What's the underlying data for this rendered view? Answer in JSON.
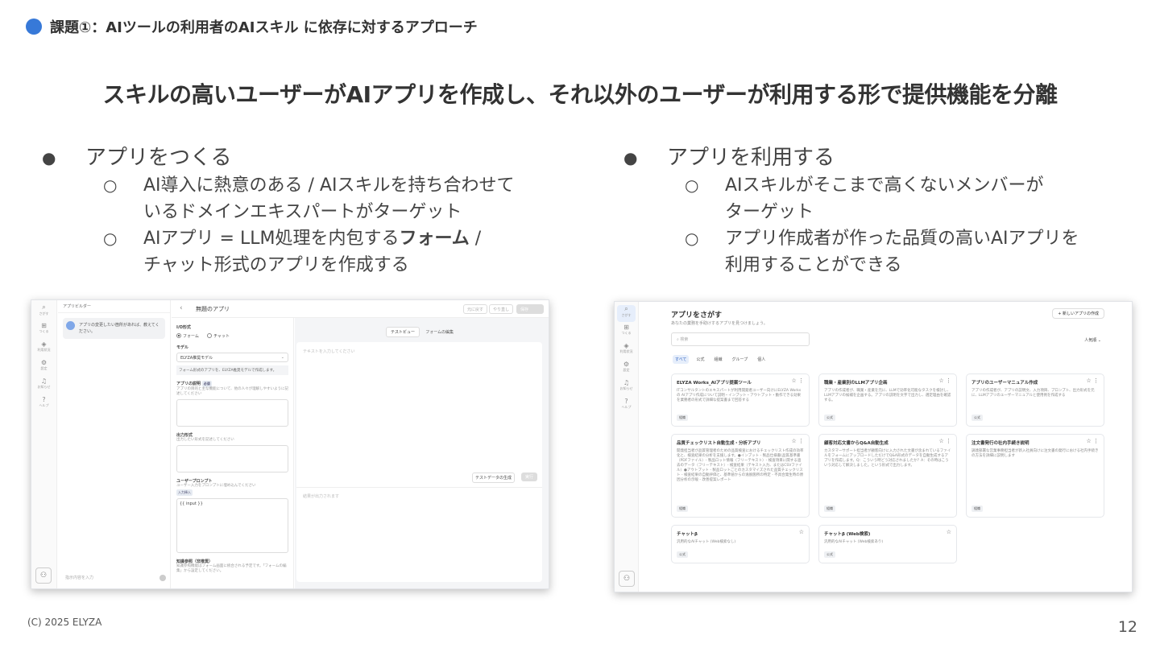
{
  "header": {
    "title": "課題①：AIツールの利用者のAIスキル に依存に対するアプローチ"
  },
  "subtitle": "スキルの高いユーザーがAIアプリを作成し、それ以外のユーザーが利用する形で提供機能を分離",
  "left_column": {
    "heading": "アプリをつくる",
    "items": [
      {
        "line1": "AI導入に熱意のある / AIスキルを持ち合わせて",
        "line2": "いるドメインエキスパートがターゲット"
      },
      {
        "line1_pre": "AIアプリ = LLM処理を内包する",
        "line1_bold": "フォーム",
        "line1_post": " /",
        "line2": "チャット形式のアプリを作成する"
      }
    ]
  },
  "right_column": {
    "heading": "アプリを利用する",
    "items": [
      {
        "line1": "AIスキルがそこまで高くないメンバーが",
        "line2": "ターゲット"
      },
      {
        "line1": "アプリ作成者が作った品質の高いAIアプリを",
        "line2": "利用することができる"
      }
    ]
  },
  "bullets": {
    "level1": "●",
    "level2": "○"
  },
  "builder_screenshot": {
    "rail": [
      {
        "icon": "search-icon",
        "glyph": "⌕",
        "label": "さがす"
      },
      {
        "icon": "grid-icon",
        "glyph": "⊞",
        "label": "つくる"
      },
      {
        "icon": "layers-icon",
        "glyph": "◈",
        "label": "利用状況"
      },
      {
        "icon": "gear-icon",
        "glyph": "⚙",
        "label": "設定"
      },
      {
        "icon": "bell-icon",
        "glyph": "♫",
        "label": "お知らせ"
      },
      {
        "icon": "help-icon",
        "glyph": "?",
        "label": "ヘルプ"
      }
    ],
    "panel_title": "アプリビルダー",
    "chat_message": "アプリの変更したい箇所があれば、教えてください。",
    "chat_placeholder": "指示内容を入力",
    "app_title": "無題のアプリ",
    "undo": "元に戻す",
    "redo": "やり直し",
    "save": "保存",
    "io_label": "I/O形式",
    "io_form": "フォーム",
    "io_chat": "チャット",
    "model_label": "モデル",
    "model_value": "ELYZA推奨モデル",
    "model_note": "フォーム形式のアプリを、ELYZA推奨モデルで作成します。",
    "desc_label": "アプリの説明",
    "desc_badge": "必須",
    "desc_help": "アプリの目的と主な機能について、他の人々が理解しやすいように記述してください",
    "output_label": "出力形式",
    "output_help": "出力したい形式を記述してください",
    "prompt_label": "ユーザープロンプト",
    "prompt_help": "ユーザー入力をプロンプトに埋め込んでください",
    "prompt_badge": "入力挿入",
    "prompt_value": "{{ input }}",
    "knowledge_label": "知識参照（非推奨）",
    "knowledge_help": "知識参照機能はフォーム画面に統合される予定です。「フォームの編集」から設定してください。",
    "tab_preview": "テストビュー",
    "tab_edit": "フォームの編集",
    "input_placeholder": "テキストを入力してください",
    "gen_button": "テストデータの生成",
    "run_button": "実行",
    "output_placeholder": "結果が出力されます"
  },
  "store_screenshot": {
    "rail": [
      {
        "icon": "search-icon",
        "glyph": "⌕",
        "label": "さがす"
      },
      {
        "icon": "grid-icon",
        "glyph": "⊞",
        "label": "つくる"
      },
      {
        "icon": "layers-icon",
        "glyph": "◈",
        "label": "利用状況"
      },
      {
        "icon": "gear-icon",
        "glyph": "⚙",
        "label": "設定"
      },
      {
        "icon": "bell-icon",
        "glyph": "♫",
        "label": "お知らせ"
      },
      {
        "icon": "help-icon",
        "glyph": "?",
        "label": "ヘルプ"
      }
    ],
    "title": "アプリをさがす",
    "subtitle": "あなたの業務を手助けするアプリを見つけましょう。",
    "new_button": "+ 新しいアプリの作成",
    "search_placeholder": "検索",
    "sort": "人気順 ⌄",
    "filters": [
      "すべて",
      "公式",
      "組織",
      "グループ",
      "個人"
    ],
    "cards": [
      {
        "title": "ELYZA Works_AIアプリ提案ツール",
        "desc": "ITコンサルタントのエキスパートが利用開発者ユーザー向けにELYZA Worksの AIアプリ作成について説明・インプット・アウトプット・動作できる効果を業務者の形式で詳細な提案書まで回答する",
        "tag": "組織"
      },
      {
        "title": "職業・産業別のLLMアプリ企画",
        "desc": "アプリの作成者が、職業・産業を元に、LLMで効率化可能なタスクを検討し、LLMアプリの候補を企画する。アプリの説明を文字で出力し、選定理由を確認する。",
        "tag": "公式"
      },
      {
        "title": "アプリのユーザーマニュアル作成",
        "desc": "アプリの作成者が、アプリの説明文、入力項目、プロンプト、出力形式を元に、LLMアプリのユーザーマニュアルと使用例を作成する",
        "tag": "公式"
      },
      {
        "title": "品質チェックリスト自動生成・分析アプリ",
        "desc": "開発担当者が品質管理者のための品質検査におけるチェックリスト作成の効率化と、検査結果の分析を支援します。●インプット - 製品仕様書(品質基準書（PDFファイル）- 製品ロット情報（フリーテキスト）- 検査項目に関する過去のデータ（フリーテキスト）- 検査結果（テキスト入力、またはCSVファイル）●アウトプット - 製品ロットごとのカスタマイズされた品質チェックリスト - 検査結果の自動評価と、基準値からの逸脱箇所の特定 - 不具合発生時の原因分析の示唆 - 改善提案レポート",
        "tag": "組織"
      },
      {
        "title": "顧客対応文書からQ&A自動生成",
        "desc": "カスタマーサポート担当者が顧客向けに入力された文書が含まれているファイルをフォームにアップロードしただけでQ&A形式のデータを自動生成するアプリを作成します。Q：こういう時どう対応されましたか？A：その時はこういう対応して解決しました。という形式で出力します。",
        "tag": "組織"
      },
      {
        "title": "注文書発行の社内手続き説明",
        "desc": "調達部署な営業事務担当者が新入社員向けに注文書の発行における社内手続きの方法を詳細に説明します",
        "tag": "組織"
      },
      {
        "title": "チャットβ",
        "desc": "汎用的なAIチャット (Web検索なし)",
        "tag": "公式"
      },
      {
        "title": "チャットβ (Web検索)",
        "desc": "汎用的なAIチャット (Web検索あり)",
        "tag": "公式"
      }
    ]
  },
  "footer": {
    "copyright": "(C) 2025 ELYZA",
    "page_number": "12"
  },
  "colors": {
    "accent": "#3779d8"
  }
}
